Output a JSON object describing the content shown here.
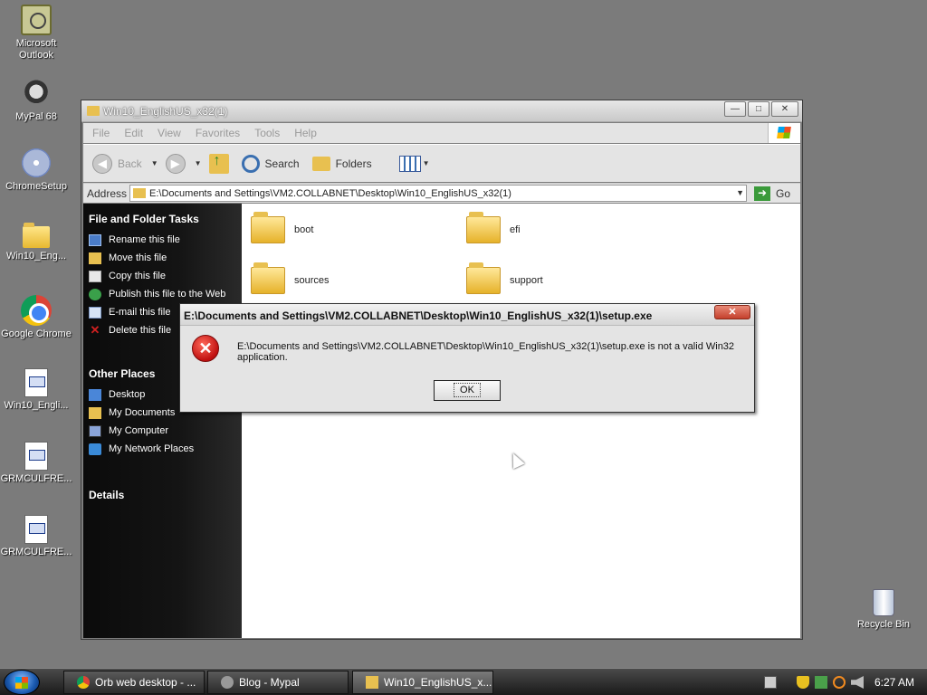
{
  "desktop": {
    "icons": [
      {
        "label": "Microsoft Outlook",
        "icon": "outlook-icon"
      },
      {
        "label": "MyPal 68",
        "icon": "mypal-icon"
      },
      {
        "label": "ChromeSetup",
        "icon": "cd-installer-icon"
      },
      {
        "label": "Win10_Eng...",
        "icon": "folder-icon"
      },
      {
        "label": "Google Chrome",
        "icon": "chrome-icon"
      },
      {
        "label": "Win10_Engli...",
        "icon": "file-icon"
      },
      {
        "label": "GRMCULFRE...",
        "icon": "file-icon"
      },
      {
        "label": "GRMCULFRE...",
        "icon": "file-icon"
      },
      {
        "label": "Recycle Bin",
        "icon": "recycle-bin-icon"
      }
    ]
  },
  "explorer": {
    "title": "Win10_EnglishUS_x32(1)",
    "window_buttons": {
      "minimize": "—",
      "maximize": "□",
      "close": "✕"
    },
    "menu": [
      "File",
      "Edit",
      "View",
      "Favorites",
      "Tools",
      "Help"
    ],
    "toolbar": {
      "back": "Back",
      "search": "Search",
      "folders": "Folders"
    },
    "address": {
      "label": "Address",
      "value": "E:\\Documents and Settings\\VM2.COLLABNET\\Desktop\\Win10_EnglishUS_x32(1)",
      "go": "Go"
    },
    "file_tasks": {
      "title": "File and Folder Tasks",
      "items": [
        "Rename this file",
        "Move this file",
        "Copy this file",
        "Publish this file to the Web",
        "E-mail this file",
        "Delete this file"
      ]
    },
    "other_places": {
      "title": "Other Places",
      "items": [
        "Desktop",
        "My Documents",
        "My Computer",
        "My Network Places"
      ]
    },
    "details": {
      "title": "Details"
    },
    "folders": [
      "boot",
      "efi",
      "sources",
      "support"
    ]
  },
  "dialog": {
    "title": "E:\\Documents and Settings\\VM2.COLLABNET\\Desktop\\Win10_EnglishUS_x32(1)\\setup.exe",
    "message": "E:\\Documents and Settings\\VM2.COLLABNET\\Desktop\\Win10_EnglishUS_x32(1)\\setup.exe is not a valid Win32 application.",
    "ok": "OK",
    "close": "✕"
  },
  "taskbar": {
    "buttons": [
      {
        "label": "Orb web desktop - ...",
        "icon": "chrome-icon"
      },
      {
        "label": "Blog - Mypal",
        "icon": "mypal-icon"
      },
      {
        "label": "Win10_EnglishUS_x...",
        "icon": "folder-icon",
        "active": true
      }
    ],
    "clock": "6:27 AM"
  }
}
